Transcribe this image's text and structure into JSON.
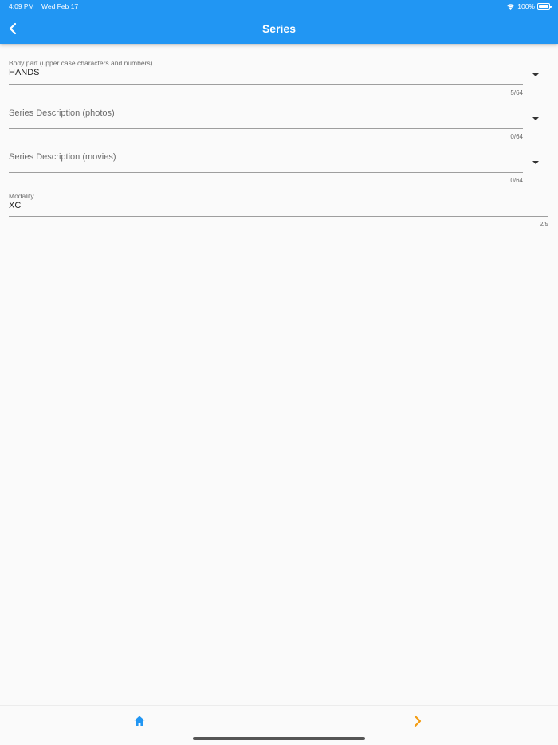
{
  "status_bar": {
    "time": "4:09 PM",
    "date": "Wed Feb 17",
    "battery": "100%"
  },
  "appbar": {
    "title": "Series"
  },
  "form": {
    "body_part": {
      "label": "Body part (upper case characters and numbers)",
      "value": "HANDS",
      "counter": "5/64"
    },
    "series_photos": {
      "label": "Series Description (photos)",
      "value": "",
      "counter": "0/64"
    },
    "series_movies": {
      "label": "Series Description (movies)",
      "value": "",
      "counter": "0/64"
    },
    "modality": {
      "label": "Modality",
      "value": "XC",
      "counter": "2/5"
    }
  },
  "colors": {
    "primary": "#2196f3",
    "next_accent": "#f39c12",
    "home_icon": "#2196f3"
  },
  "icons": {
    "back": "chevron-left-icon",
    "home": "home-icon",
    "next": "chevron-right-icon",
    "dropdown": "caret-down-icon",
    "wifi": "wifi-icon",
    "battery": "battery-icon"
  }
}
